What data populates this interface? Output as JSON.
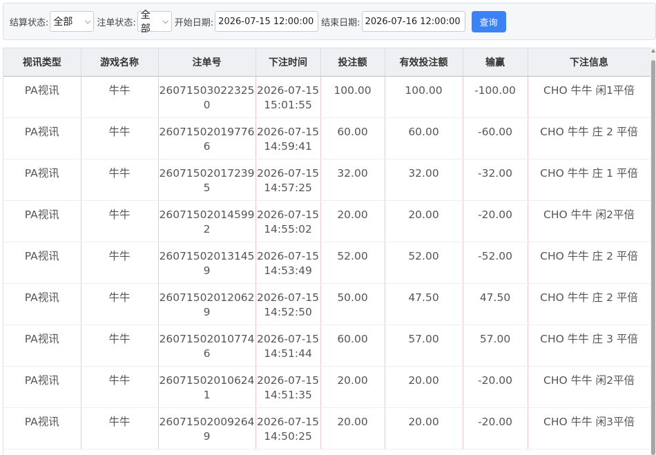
{
  "filters": {
    "settle_status_label": "结算状态:",
    "settle_status_value": "全部",
    "bet_status_label": "注单状态:",
    "bet_status_value": "全部",
    "start_date_label": "开始日期:",
    "start_date_value": "2026-07-15 12:00:00",
    "end_date_label": "结束日期:",
    "end_date_value": "2026-07-16 12:00:00",
    "query_label": "查询"
  },
  "table": {
    "headers": [
      "视讯类型",
      "游戏名称",
      "注单号",
      "下注时间",
      "投注额",
      "有效投注额",
      "输赢",
      "下注信息"
    ],
    "rows": [
      [
        "PA视讯",
        "牛牛",
        "260715030223250",
        "2026-07-15 15:01:55",
        "100.00",
        "100.00",
        "-100.00",
        "CHO 牛牛 闲1平倍"
      ],
      [
        "PA视讯",
        "牛牛",
        "260715020197766",
        "2026-07-15 14:59:41",
        "60.00",
        "60.00",
        "-60.00",
        "CHO 牛牛 庄 2 平倍"
      ],
      [
        "PA视讯",
        "牛牛",
        "260715020172395",
        "2026-07-15 14:57:25",
        "32.00",
        "32.00",
        "-32.00",
        "CHO 牛牛 庄 1 平倍"
      ],
      [
        "PA视讯",
        "牛牛",
        "260715020145992",
        "2026-07-15 14:55:02",
        "20.00",
        "20.00",
        "-20.00",
        "CHO 牛牛 闲2平倍"
      ],
      [
        "PA视讯",
        "牛牛",
        "260715020131459",
        "2026-07-15 14:53:49",
        "52.00",
        "52.00",
        "-52.00",
        "CHO 牛牛 庄 2 平倍"
      ],
      [
        "PA视讯",
        "牛牛",
        "260715020120629",
        "2026-07-15 14:52:50",
        "50.00",
        "47.50",
        "47.50",
        "CHO 牛牛 庄 2 平倍"
      ],
      [
        "PA视讯",
        "牛牛",
        "260715020107746",
        "2026-07-15 14:51:44",
        "60.00",
        "57.00",
        "57.00",
        "CHO 牛牛 庄 3 平倍"
      ],
      [
        "PA视讯",
        "牛牛",
        "260715020106241",
        "2026-07-15 14:51:35",
        "20.00",
        "20.00",
        "-20.00",
        "CHO 牛牛 闲2平倍"
      ],
      [
        "PA视讯",
        "牛牛",
        "260715020092649",
        "2026-07-15 14:50:25",
        "20.00",
        "20.00",
        "-20.00",
        "CHO 牛牛 闲3平倍"
      ]
    ]
  }
}
